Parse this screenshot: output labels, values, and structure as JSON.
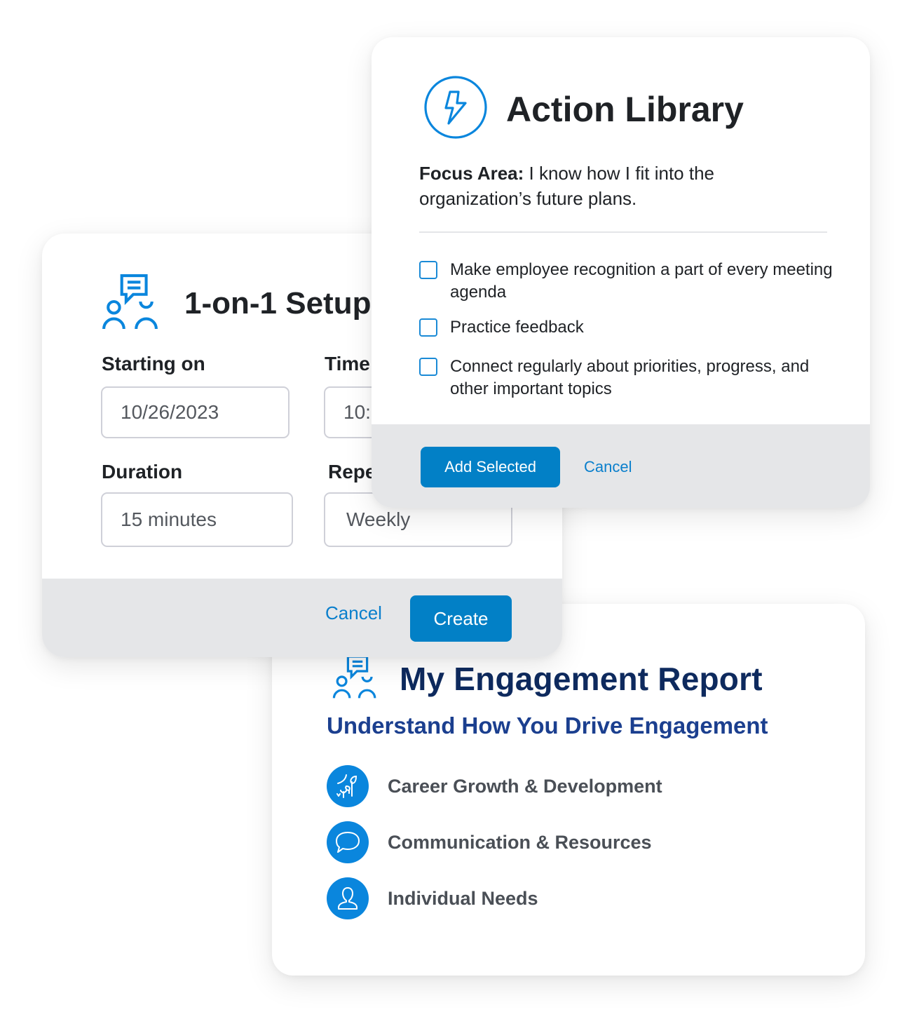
{
  "colors": {
    "accent": "#0280c6",
    "icon_blue": "#0a86dd",
    "report_title": "#0e2a5e",
    "report_subtitle": "#1b3f8f",
    "footer_gray": "#e5e6e8"
  },
  "action_library": {
    "title": "Action Library",
    "icon": "lightning-bolt-icon",
    "focus_label": "Focus Area:",
    "focus_text": " I know how I fit into the organization’s future plans.",
    "options": [
      {
        "label": "Make employee recognition a part of every meeting agenda",
        "checked": false
      },
      {
        "label": "Practice feedback",
        "checked": false
      },
      {
        "label": "Connect regularly about priorities, progress, and other important topics",
        "checked": false
      }
    ],
    "add_button": "Add Selected",
    "cancel_button": "Cancel"
  },
  "setup": {
    "title": "1-on-1 Setup",
    "icon": "people-chat-icon",
    "fields": {
      "starting_on": {
        "label": "Starting on",
        "value": "10/26/2023"
      },
      "time": {
        "label": "Time",
        "value": "10:"
      },
      "duration": {
        "label": "Duration",
        "value": "15 minutes"
      },
      "repeat": {
        "label": "Repe",
        "value": "Weekly"
      }
    },
    "cancel_button": "Cancel",
    "create_button": "Create"
  },
  "report": {
    "title": "My Engagement Report",
    "icon": "people-chat-icon",
    "subtitle": "Understand How You Drive Engagement",
    "items": [
      {
        "label": "Career Growth & Development",
        "icon": "sprout-growth-icon"
      },
      {
        "label": "Communication & Resources",
        "icon": "speech-bubble-icon"
      },
      {
        "label": "Individual Needs",
        "icon": "person-icon"
      }
    ]
  }
}
